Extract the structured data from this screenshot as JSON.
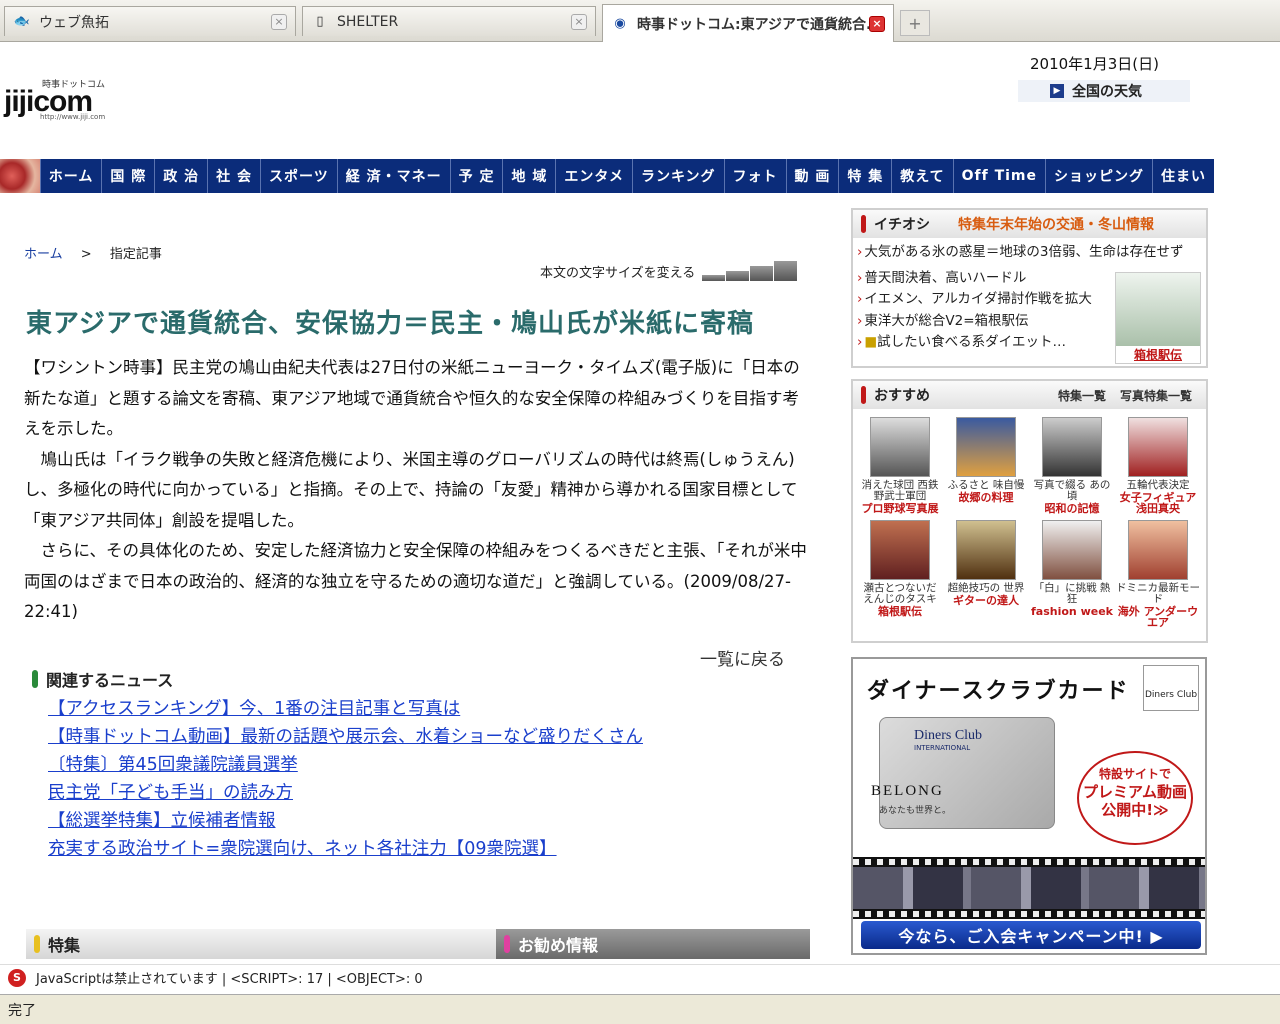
{
  "browser": {
    "tabs": [
      {
        "label": "ウェブ魚拓",
        "icon": "fish-icon",
        "active": false
      },
      {
        "label": "SHELTER",
        "icon": "document-icon",
        "active": false
      },
      {
        "label": "時事ドットコム:東アジアで通貨統合...",
        "icon": "jiji-favicon",
        "active": true
      }
    ],
    "new_tab_label": "+",
    "close_label": "×"
  },
  "header": {
    "logo_small": "時事ドットコム",
    "logo_big": "jijicom",
    "logo_url": "http://www.jiji.com",
    "date": "2010年1月3日(日)",
    "weather": "全国の天気"
  },
  "nav": {
    "items": [
      "ホーム",
      "国 際",
      "政 治",
      "社 会",
      "スポーツ",
      "経 済・マネー",
      "予 定",
      "地 域",
      "エンタメ",
      "ランキング",
      "フォト",
      "動 画",
      "特 集",
      "教えて",
      "Off Time",
      "ショッピング",
      "住まい"
    ]
  },
  "breadcrumb": {
    "home": "ホーム",
    "sep": ">",
    "current": "指定記事"
  },
  "font_size_label": "本文の文字サイズを変える",
  "article": {
    "headline": "東アジアで通貨統合、安保協力＝民主・鳩山氏が米紙に寄稿",
    "paragraphs": [
      "【ワシントン時事】民主党の鳩山由紀夫代表は27日付の米紙ニューヨーク・タイムズ(電子版)に「日本の新たな道」と題する論文を寄稿、東アジア地域で通貨統合や恒久的な安全保障の枠組みづくりを目指す考えを示した。",
      "　鳩山氏は「イラク戦争の失敗と経済危機により、米国主導のグローバリズムの時代は終焉(しゅうえん)し、多極化の時代に向かっている」と指摘。その上で、持論の「友愛」精神から導かれる国家目標として「東アジア共同体」創設を提唱した。",
      "　さらに、その具体化のため、安定した経済協力と安全保障の枠組みをつくるべきだと主張、「それが米中両国のはざまで日本の政治的、経済的な独立を守るための適切な道だ」と強調している。(2009/08/27-22:41)"
    ],
    "back_link": "一覧に戻る"
  },
  "related": {
    "title": "関連するニュース",
    "links": [
      "【アクセスランキング】今、1番の注目記事と写真は",
      "【時事ドットコム動画】最新の話題や展示会、水着ショーなど盛りだくさん",
      "〔特集〕第45回衆議院議員選挙",
      "民主党「子ども手当」の読み方",
      "【総選挙特集】立候補者情報",
      "充実する政治サイト=衆院選向け、ネット各社注力【09衆院選】"
    ]
  },
  "bottom_tabs": {
    "left": "特集",
    "right": "お勧め情報"
  },
  "ichioshi": {
    "label": "イチオシ",
    "title": "特集年末年始の交通・冬山情報",
    "items": [
      "大気がある氷の惑星＝地球の3倍弱、生命は存在せず",
      "普天間決着、高いハードル",
      "イエメン、アルカイダ掃討作戦を拡大",
      "東洋大が総合V2=箱根駅伝",
      "試したい食べる系ダイエット…"
    ],
    "photo_caption": "箱根駅伝",
    "arrow": "›"
  },
  "osusume": {
    "label": "おすすめ",
    "link1": "特集一覧",
    "link2": "写真特集一覧",
    "cells": [
      {
        "t1": "消えた球団 西鉄野武士軍団",
        "t2": "プロ野球写真展",
        "color1": "#dddddd",
        "color2": "#555555"
      },
      {
        "t1": "ふるさと 味自慢",
        "t2": "故郷の料理",
        "color1": "#3a5aa0",
        "color2": "#e0a040"
      },
      {
        "t1": "写真で綴る あの頃",
        "t2": "昭和の記憶",
        "color1": "#cccccc",
        "color2": "#333333"
      },
      {
        "t1": "五輪代表決定",
        "t2": "女子フィギュア 浅田真央",
        "color1": "#f0e0e0",
        "color2": "#a02020"
      },
      {
        "t1": "瀬古とつないだ えんじのタスキ",
        "t2": "箱根駅伝",
        "color1": "#c07050",
        "color2": "#602020"
      },
      {
        "t1": "超絶技巧の 世界",
        "t2": "ギターの達人",
        "color1": "#d0c090",
        "color2": "#503010"
      },
      {
        "t1": "「白」に挑戦 熱狂",
        "t2": "fashion week",
        "color1": "#f0f0f0",
        "color2": "#805040"
      },
      {
        "t1": "ドミニカ最新モード",
        "t2": "海外 アンダーウエア",
        "color1": "#f0c0a0",
        "color2": "#a04030"
      }
    ]
  },
  "ad": {
    "title": "ダイナースクラブカード",
    "logo": "Diners Club",
    "card_brand": "Diners Club",
    "card_brand2": "INTERNATIONAL",
    "belong": "BELONG",
    "belong2": "あなたも世界と。",
    "badge_line1": "特設サイトで",
    "badge_line2": "プレミアム動画",
    "badge_line3": "公開中!≫",
    "cta": "今なら、ご入会キャンペーン中! ▶"
  },
  "status": {
    "js_message": "JavaScriptは禁止されています | <SCRIPT>: 17 | <OBJECT>: 0",
    "done": "完了"
  }
}
